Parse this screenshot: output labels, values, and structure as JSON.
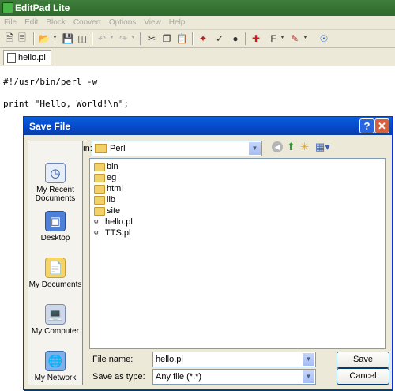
{
  "app": {
    "title": "EditPad Lite",
    "menu": [
      "File",
      "Edit",
      "Block",
      "Convert",
      "Options",
      "View",
      "Help"
    ],
    "toolbar_icons": [
      "new-file-icon",
      "open-file-icon",
      "save-icon",
      "save-all-icon",
      "undo-icon",
      "redo-icon",
      "cut-icon",
      "copy-icon",
      "paste-icon",
      "marker-icon",
      "spellcheck-icon",
      "search-icon",
      "insert-icon",
      "font-icon",
      "highlight-icon",
      "web-icon"
    ],
    "tab": {
      "label": "hello.pl"
    }
  },
  "editor": {
    "lines": [
      "#!/usr/bin/perl -w",
      "",
      "print \"Hello, World!\\n\";"
    ]
  },
  "dialog": {
    "title": "Save File",
    "help_glyph": "?",
    "close_glyph": "✕",
    "save_in_label": "Save in:",
    "save_in_value": "Perl",
    "places": [
      "My Recent\nDocuments",
      "Desktop",
      "My Documents",
      "My Computer",
      "My Network"
    ],
    "places_lines": [
      [
        "My Recent",
        "Documents"
      ],
      [
        "Desktop"
      ],
      [
        "My Documents"
      ],
      [
        "My Computer"
      ],
      [
        "My Network"
      ]
    ],
    "files": [
      {
        "name": "bin",
        "type": "folder"
      },
      {
        "name": "eg",
        "type": "folder"
      },
      {
        "name": "html",
        "type": "folder"
      },
      {
        "name": "lib",
        "type": "folder"
      },
      {
        "name": "site",
        "type": "folder"
      },
      {
        "name": "hello.pl",
        "type": "perl"
      },
      {
        "name": "TTS.pl",
        "type": "perl"
      }
    ],
    "file_name_label": "File name:",
    "file_name_value": "hello.pl",
    "save_as_type_label": "Save as type:",
    "save_as_type_value": "Any file (*.*)",
    "save_button": "Save",
    "cancel_button": "Cancel"
  },
  "colors": {
    "title_green": "#2e6a2b",
    "dialog_title_blue": "#0548c9",
    "close_red": "#d75e3f"
  }
}
